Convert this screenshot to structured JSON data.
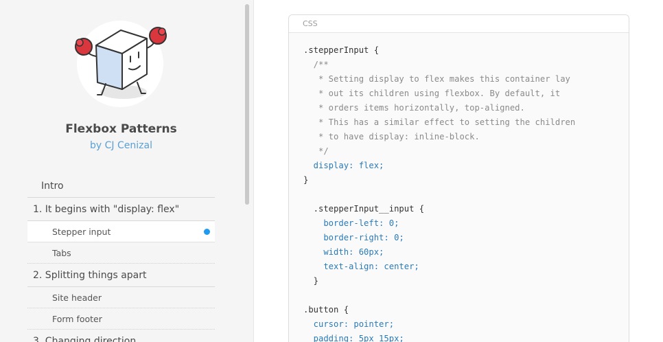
{
  "brand": {
    "title": "Flexbox Patterns",
    "author": "by CJ Cenizal"
  },
  "nav": {
    "intro": "Intro",
    "section1": "1. It begins with \"display: flex\"",
    "sub_stepper": "Stepper input",
    "sub_tabs": "Tabs",
    "section2": "2. Splitting things apart",
    "sub_site_header": "Site header",
    "sub_form_footer": "Form footer",
    "section3": "3. Changing direction"
  },
  "code": {
    "language_label": "CSS",
    "lines": [
      ".stepperInput {",
      "  /**",
      "   * Setting display to flex makes this container lay",
      "   * out its children using flexbox. By default, it",
      "   * orders items horizontally, top-aligned.",
      "   * This has a similar effect to setting the children",
      "   * to have display: inline-block.",
      "   */",
      "  display: flex;",
      "}",
      "",
      "  .stepperInput__input {",
      "    border-left: 0;",
      "    border-right: 0;",
      "    width: 60px;",
      "    text-align: center;",
      "  }",
      "",
      ".button {",
      "  cursor: pointer;",
      "  padding: 5px 15px;"
    ]
  },
  "colors": {
    "accent": "#1e9bf0",
    "author_link": "#5a9fd6",
    "property": "#2a7ab8",
    "comment": "#8a8a8a"
  }
}
